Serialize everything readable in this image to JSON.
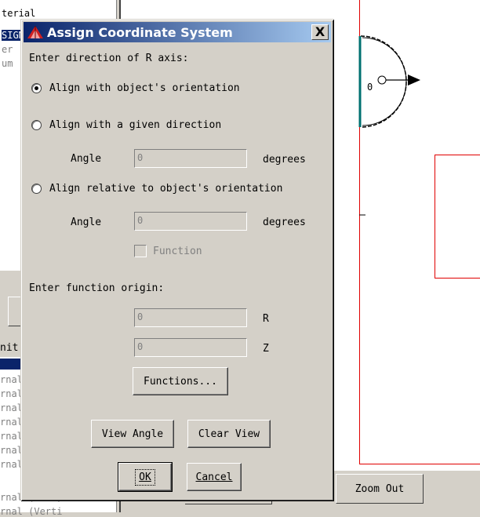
{
  "background": {
    "list_top_rows": [
      "terial",
      "SIGN",
      "er",
      "um"
    ],
    "unit_label": "nit:",
    "list_bottom_rows": [
      "",
      "rnal",
      "rnal",
      "rnal",
      "rnal",
      "rnal",
      "rnal",
      "rnal",
      "rnal (Back)",
      "rnal (Verti"
    ],
    "zoom_out_label": "Zoom Out",
    "canvas_marker": "0"
  },
  "dialog": {
    "title": "Assign Coordinate System",
    "close_label": "X",
    "direction_heading": "Enter direction of R axis:",
    "options": [
      {
        "label": "Align with object's orientation",
        "checked": true
      },
      {
        "label": "Align with a given direction",
        "checked": false
      },
      {
        "label": "Align relative to object's orientation",
        "checked": false
      }
    ],
    "angle_label_1": "Angle",
    "angle_value_1": "0",
    "angle_unit_1": "degrees",
    "angle_label_2": "Angle",
    "angle_value_2": "0",
    "angle_unit_2": "degrees",
    "function_checkbox_label": "Function",
    "origin_heading": "Enter function origin:",
    "r_value": "0",
    "r_label": "R",
    "z_value": "0",
    "z_label": "Z",
    "functions_button": "Functions...",
    "view_angle_button": "View Angle",
    "clear_view_button": "Clear View",
    "ok_button": "OK",
    "cancel_button": "Cancel"
  }
}
